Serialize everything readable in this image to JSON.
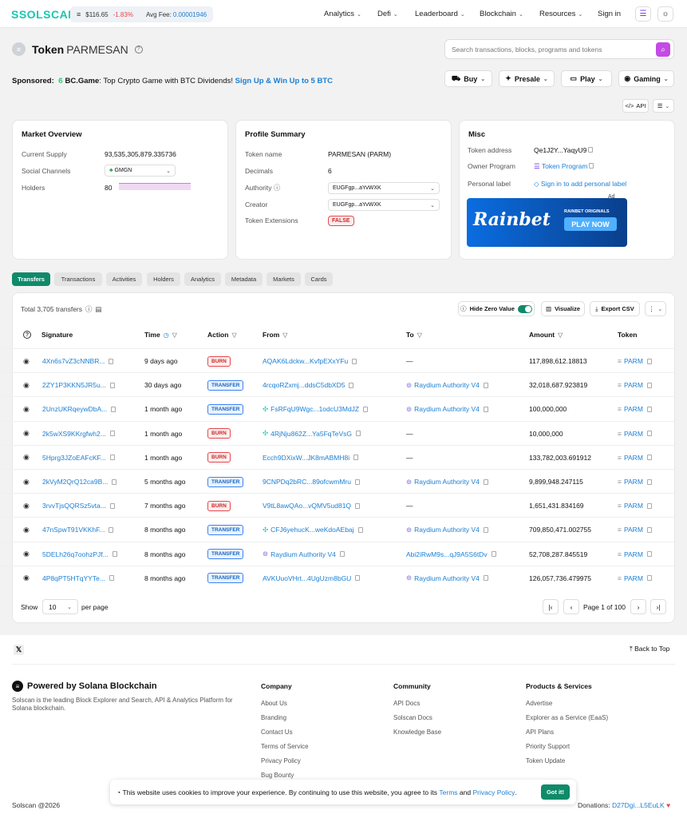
{
  "header": {
    "logo": "SOLSCAN",
    "price": "$116.65",
    "change": "-1.83%",
    "fee_label": "Avg Fee:",
    "fee": "0.00001946",
    "nav": [
      "Analytics",
      "Defi",
      "Leaderboard",
      "Blockchain",
      "Resources"
    ],
    "signin": "Sign in"
  },
  "title": {
    "prefix": "Token",
    "name": "PARMESAN"
  },
  "search": {
    "placeholder": "Search transactions, blocks, programs and tokens"
  },
  "sponsored": {
    "label": "Sponsored:",
    "brand": "BC.Game",
    "text": ": Top Crypto Game with BTC Dividends!",
    "cta": "Sign Up & Win Up to 5 BTC"
  },
  "sponsor_buttons": [
    "Buy",
    "Presale",
    "Play",
    "Gaming"
  ],
  "api_label": "API",
  "market": {
    "title": "Market Overview",
    "supply_label": "Current Supply",
    "supply": "93,535,305,879.335736",
    "social_label": "Social Channels",
    "social": "GMGN",
    "holders_label": "Holders",
    "holders": "80"
  },
  "profile": {
    "title": "Profile Summary",
    "name_label": "Token name",
    "name": "PARMESAN (PARM)",
    "decimals_label": "Decimals",
    "decimals": "6",
    "authority_label": "Authority",
    "authority": "EUGFgp...aYvWXK",
    "creator_label": "Creator",
    "creator": "EUGFgp...aYvWXK",
    "ext_label": "Token Extensions",
    "ext": "FALSE"
  },
  "misc": {
    "title": "Misc",
    "addr_label": "Token address",
    "addr": "Qe1J2Y...YaqyU9",
    "owner_label": "Owner Program",
    "owner": "Token Program",
    "plabel_label": "Personal label",
    "plabel": "Sign in to add personal label",
    "ad_tag": "Ad",
    "ad_brand": "Rainbet",
    "ad_sub": "RAINBET ORIGINALS",
    "ad_cta": "PLAY NOW"
  },
  "tabs": [
    "Transfers",
    "Transactions",
    "Activities",
    "Holders",
    "Analytics",
    "Metadata",
    "Markets",
    "Cards"
  ],
  "table": {
    "total": "Total 3,705 transfers",
    "hide_zero": "Hide Zero Value",
    "visualize": "Visualize",
    "export": "Export CSV",
    "headers": [
      "Signature",
      "Time",
      "Action",
      "From",
      "To",
      "Amount",
      "Token"
    ],
    "rows": [
      {
        "sig": "4Xn6s7vZ3cNNBR...",
        "time": "9 days ago",
        "action": "BURN",
        "from": "AQAK6Ldckw...KvfpEXxYFu",
        "to": "—",
        "amount": "117,898,612.18813",
        "token": "PARM"
      },
      {
        "sig": "2ZY1P3KKN5JR5u...",
        "time": "30 days ago",
        "action": "TRANSFER",
        "from": "4rcqoRZxmj...ddsC5dbXD5",
        "to": "Raydium Authority V4",
        "amount": "32,018,687.923819",
        "token": "PARM"
      },
      {
        "sig": "2UnzUKRqeywDbA...",
        "time": "1 month ago",
        "action": "TRANSFER",
        "from": "FsRFqU9Wgc...1odcU3MdJZ",
        "to": "Raydium Authority V4",
        "amount": "100,000,000",
        "token": "PARM"
      },
      {
        "sig": "2k5wXS9KKrgfwh2...",
        "time": "1 month ago",
        "action": "BURN",
        "from": "4RjNju862Z...Ya5FqTeVsG",
        "to": "—",
        "amount": "10,000,000",
        "token": "PARM"
      },
      {
        "sig": "5Hprg3JZoEAFcKF...",
        "time": "1 month ago",
        "action": "BURN",
        "from": "Ecch9DXixW...JK8mABMH8i",
        "to": "—",
        "amount": "133,782,003.691912",
        "token": "PARM"
      },
      {
        "sig": "2kVyM2QrQ12ca9B...",
        "time": "5 months ago",
        "action": "TRANSFER",
        "from": "9CNPDq2bRC...89ofcwmMru",
        "to": "Raydium Authority V4",
        "amount": "9,899,948.247115",
        "token": "PARM"
      },
      {
        "sig": "3rvvTjsQQRSz5vta...",
        "time": "7 months ago",
        "action": "BURN",
        "from": "V9tL8awQAo...vQMV5ud81Q",
        "to": "—",
        "amount": "1,651,431.834169",
        "token": "PARM"
      },
      {
        "sig": "47nSpwT91VKKhF...",
        "time": "8 months ago",
        "action": "TRANSFER",
        "from": "CFJ6yehucK...weKdoAEbaj",
        "to": "Raydium Authority V4",
        "amount": "709,850,471.002755",
        "token": "PARM"
      },
      {
        "sig": "5DELh26q7oohzPJf...",
        "time": "8 months ago",
        "action": "TRANSFER",
        "from": "Raydium Authority V4",
        "to": "Abi2iRwM9s...qJ9A5S6tDv",
        "amount": "52,708,287.845519",
        "token": "PARM"
      },
      {
        "sig": "4P8qPT5HTqYYTe...",
        "time": "8 months ago",
        "action": "TRANSFER",
        "from": "AVKUuoVHrt...4UgUzm8bGU",
        "to": "Raydium Authority V4",
        "amount": "126,057,736.479975",
        "token": "PARM"
      }
    ],
    "show": "Show",
    "per_page": "10",
    "per_page_suffix": "per page",
    "page": "Page 1 of 100"
  },
  "footer": {
    "back": "Back to Top",
    "powered": "Powered by Solana Blockchain",
    "desc": "Solscan is the leading Block Explorer and Search, API & Analytics Platform for Solana blockchain.",
    "company_title": "Company",
    "company": [
      "About Us",
      "Branding",
      "Contact Us",
      "Terms of Service",
      "Privacy Policy",
      "Bug Bounty"
    ],
    "community_title": "Community",
    "community": [
      "API Docs",
      "Solscan Docs",
      "Knowledge Base"
    ],
    "products_title": "Products & Services",
    "products": [
      "Advertise",
      "Explorer as a Service (EaaS)",
      "API Plans",
      "Priority Support",
      "Token Update"
    ],
    "copyright": "Solscan @2026",
    "donations_label": "Donations:",
    "donations": "D27Dgi...L5EuLK"
  },
  "cookie": {
    "text": "This website uses cookies to improve your experience. By continuing to use this website, you agree to its",
    "terms": "Terms",
    "and": "and",
    "privacy": "Privacy Policy",
    "period": ".",
    "button": "Got it!"
  }
}
